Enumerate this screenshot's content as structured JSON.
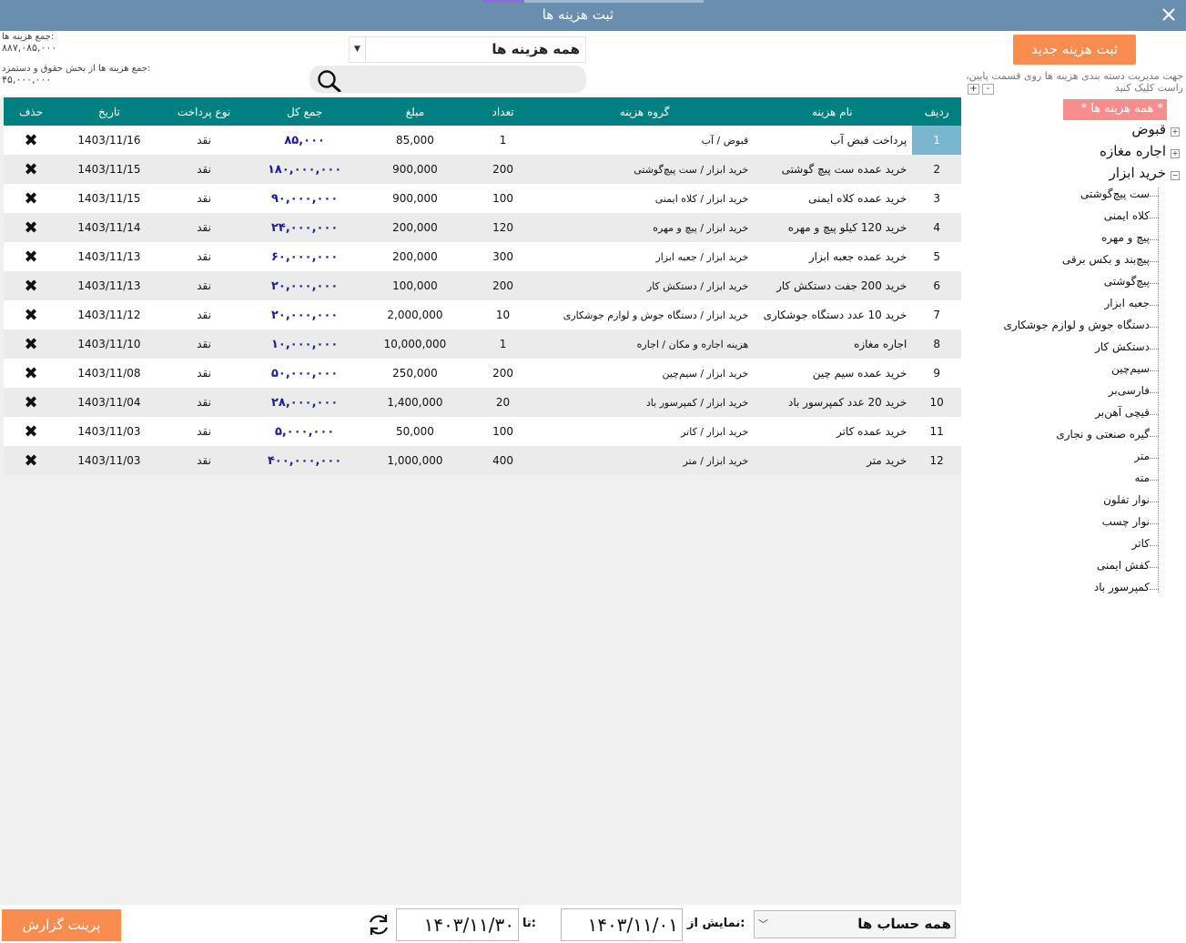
{
  "window": {
    "title": "ثبت هزینه ها",
    "close_label": "✕"
  },
  "summary": {
    "total_label": "جمع هزینه ها:",
    "total_value": "۸۸۷,۰۸۵,۰۰۰",
    "salary_label": "جمع هزینه ها از بخش حقوق و دستمزد:",
    "salary_value": "۴۵,۰۰۰,۰۰۰"
  },
  "filter": {
    "category_selected": "همه هزینه ها",
    "search_placeholder": ""
  },
  "grid": {
    "headers": [
      "ردیف",
      "نام هزینه",
      "گروه هزینه",
      "تعداد",
      "مبلغ",
      "جمع کل",
      "نوع پرداخت",
      "تاریخ",
      "حذف"
    ],
    "rows": [
      {
        "idx": "1",
        "name": "پرداخت قبض آب",
        "group": "قبوض / آب",
        "qty": "1",
        "price": "85,000",
        "total": "۸۵,۰۰۰",
        "pay": "نقد",
        "date": "1403/11/16"
      },
      {
        "idx": "2",
        "name": "خرید عمده ست پیچ گوشتی",
        "group": "خرید ابزار  /  ست پیچ‌گوشتی",
        "qty": "200",
        "price": "900,000",
        "total": "۱۸۰,۰۰۰,۰۰۰",
        "pay": "نقد",
        "date": "1403/11/15"
      },
      {
        "idx": "3",
        "name": "خرید عمده کلاه ایمنی",
        "group": "خرید ابزار  /  کلاه ایمنی",
        "qty": "100",
        "price": "900,000",
        "total": "۹۰,۰۰۰,۰۰۰",
        "pay": "نقد",
        "date": "1403/11/15"
      },
      {
        "idx": "4",
        "name": "خرید 120 کیلو پیچ و مهره",
        "group": "خرید ابزار  /  پیچ و مهره",
        "qty": "120",
        "price": "200,000",
        "total": "۲۴,۰۰۰,۰۰۰",
        "pay": "نقد",
        "date": "1403/11/14"
      },
      {
        "idx": "5",
        "name": "خرید عمده جعبه ابزار",
        "group": "خرید ابزار  /  جعبه ابزار",
        "qty": "300",
        "price": "200,000",
        "total": "۶۰,۰۰۰,۰۰۰",
        "pay": "نقد",
        "date": "1403/11/13"
      },
      {
        "idx": "6",
        "name": "خرید 200 جفت دستکش کار",
        "group": "خرید ابزار  /  دستکش کار",
        "qty": "200",
        "price": "100,000",
        "total": "۲۰,۰۰۰,۰۰۰",
        "pay": "نقد",
        "date": "1403/11/13"
      },
      {
        "idx": "7",
        "name": "خرید 10 عدد دستگاه جوشکاری",
        "group": "خرید ابزار  /  دستگاه جوش و لوازم جوشکاری",
        "qty": "10",
        "price": "2,000,000",
        "total": "۲۰,۰۰۰,۰۰۰",
        "pay": "نقد",
        "date": "1403/11/12"
      },
      {
        "idx": "8",
        "name": "اجاره مغازه",
        "group": "هزینه اجاره و مکان / اجاره",
        "qty": "1",
        "price": "10,000,000",
        "total": "۱۰,۰۰۰,۰۰۰",
        "pay": "نقد",
        "date": "1403/11/10"
      },
      {
        "idx": "9",
        "name": "خرید عمده سیم چین",
        "group": "خرید ابزار  /  سیم‌چین",
        "qty": "200",
        "price": "250,000",
        "total": "۵۰,۰۰۰,۰۰۰",
        "pay": "نقد",
        "date": "1403/11/08"
      },
      {
        "idx": "10",
        "name": "خرید 20 عدد کمپرسور باد",
        "group": "خرید ابزار  /  کمپرسور باد",
        "qty": "20",
        "price": "1,400,000",
        "total": "۲۸,۰۰۰,۰۰۰",
        "pay": "نقد",
        "date": "1403/11/04"
      },
      {
        "idx": "11",
        "name": "خرید عمده کاتر",
        "group": "خرید ابزار  /  کاتر",
        "qty": "100",
        "price": "50,000",
        "total": "۵,۰۰۰,۰۰۰",
        "pay": "نقد",
        "date": "1403/11/03"
      },
      {
        "idx": "12",
        "name": "خرید متر",
        "group": "خرید ابزار  /  متر",
        "qty": "400",
        "price": "1,000,000",
        "total": "۴۰۰,۰۰۰,۰۰۰",
        "pay": "نقد",
        "date": "1403/11/03"
      }
    ],
    "delete_glyph": "✖"
  },
  "sidebar": {
    "new_button": "ثبت هزینه جدید",
    "hint": "جهت مدیریت دسته بندی هزینه ها روی قسمت پایین، راست کلیک کنید",
    "expand_all": "+",
    "collapse_all": "-",
    "root": "* همه هزینه ها *",
    "nodes": [
      "قبوض",
      "اجاره مغازه",
      "خرید ابزار"
    ],
    "children": [
      "ست پیچ‌گوشتی",
      "کلاه ایمنی",
      "پیچ و مهره",
      "پیچ‌بند و بکس برقی",
      "پیچ‌گوشتی",
      "جعبه ابزار",
      "دستگاه جوش و لوازم جوشکاری",
      "دستکش کار",
      "سیم‌چین",
      "فارسی‌بر",
      "قیچی آهن‌بر",
      "گیره صنعتی و نجاری",
      "متر",
      "مته",
      "نوار تفلون",
      "نوار چسب",
      "کاتر",
      "کفش ایمنی",
      "کمپرسور باد"
    ]
  },
  "bottom": {
    "print_button": "پرینت گزارش",
    "to_label": "تا:",
    "to_date": "۱۴۰۳/۱۱/۳۰",
    "from_label": "نمایش از:",
    "from_date": "۱۴۰۳/۱۱/۰۱",
    "account_selected": "همه حساب ها"
  }
}
